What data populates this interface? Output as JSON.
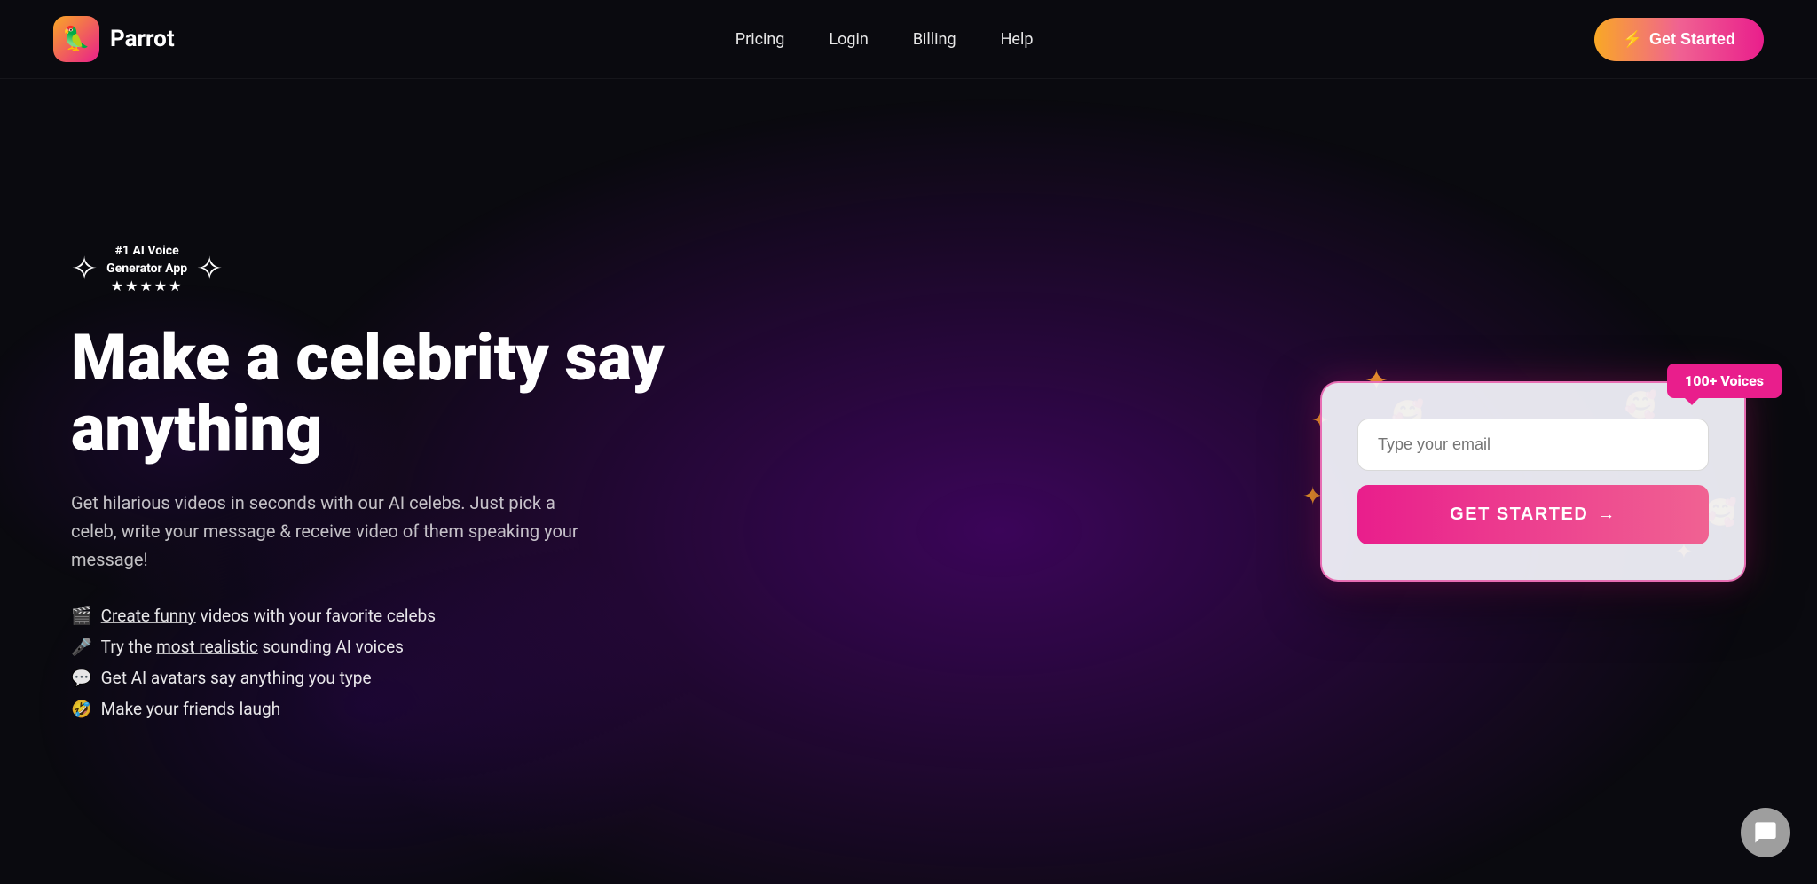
{
  "nav": {
    "logo_icon": "🦜",
    "logo_text": "Parrot",
    "links": [
      {
        "label": "Pricing",
        "id": "pricing"
      },
      {
        "label": "Login",
        "id": "login"
      },
      {
        "label": "Billing",
        "id": "billing"
      },
      {
        "label": "Help",
        "id": "help"
      }
    ],
    "cta_label": "Get Started",
    "cta_icon": "⚡"
  },
  "hero": {
    "award": {
      "title": "#1 AI Voice\nGenerator App",
      "stars": "★★★★★"
    },
    "headline": "Make a celebrity say anything",
    "subtext": "Get hilarious videos in seconds with our AI celebs. Just pick a celeb, write your message & receive video of them speaking your message!",
    "features": [
      {
        "icon": "🎬",
        "text": "Create funny",
        "rest": " videos with your favorite celebs",
        "underline": true
      },
      {
        "icon": "🎤",
        "text": "Try the ",
        "underline_text": "most realistic",
        "rest": " sounding AI voices",
        "underline": true
      },
      {
        "icon": "💬",
        "text": "Get AI avatars say ",
        "underline_text": "anything you type",
        "rest": "",
        "underline": true
      },
      {
        "icon": "🤣",
        "text": "Make your ",
        "underline_text": "friends laugh",
        "rest": "",
        "underline": true
      }
    ]
  },
  "card": {
    "email_placeholder": "Type your email",
    "submit_label": "GET STARTED",
    "submit_arrow": "→",
    "voices_badge": "100+ Voices",
    "emojis": [
      "😊",
      "😊",
      "😊"
    ],
    "sparks": [
      "✦",
      "✦",
      "✦",
      "✦",
      "✦",
      "✦"
    ]
  },
  "chat": {
    "aria_label": "Open chat"
  }
}
